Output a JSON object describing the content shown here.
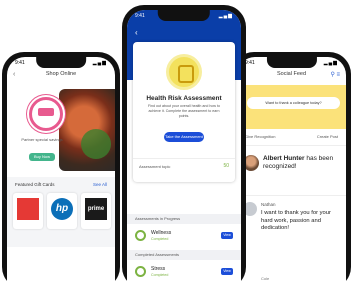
{
  "left_phone": {
    "status_time": "9:41",
    "title": "Shop Online",
    "badge_caption": "Partner special savings",
    "cta_label": "Buy Now",
    "section_title": "Featured Gift Cards",
    "see_all": "See All",
    "cards": [
      "",
      "hp",
      "prime"
    ]
  },
  "middle_phone": {
    "status_time": "9:41",
    "card_title": "Health Risk Assessment",
    "card_description": "Find out about your overall health and how to achieve it. Complete the assessment to earn points.",
    "card_button": "Take the Assessment",
    "assessment_footer": "Assessment topic",
    "assessment_points": "50",
    "section1": "Assessments in Progress",
    "row1_name": "Wellness",
    "row1_status": "Completed",
    "section2": "Completed Assessments",
    "row2_name": "Stress",
    "row2_status": "Completed",
    "view_label": "View"
  },
  "right_phone": {
    "status_time": "9:41",
    "title": "Social Feed",
    "banner_prompt": "Want to thank a colleague today?",
    "give_recognition": "Give Recognition",
    "create_post": "Create Post",
    "post1_name": "Albert Hunter",
    "post1_text": " has been recognized!",
    "post2_name": "Nathan",
    "post2_message": "I want to thank you for your hard work, passion and dedication!",
    "post2_signature": "Cole"
  }
}
